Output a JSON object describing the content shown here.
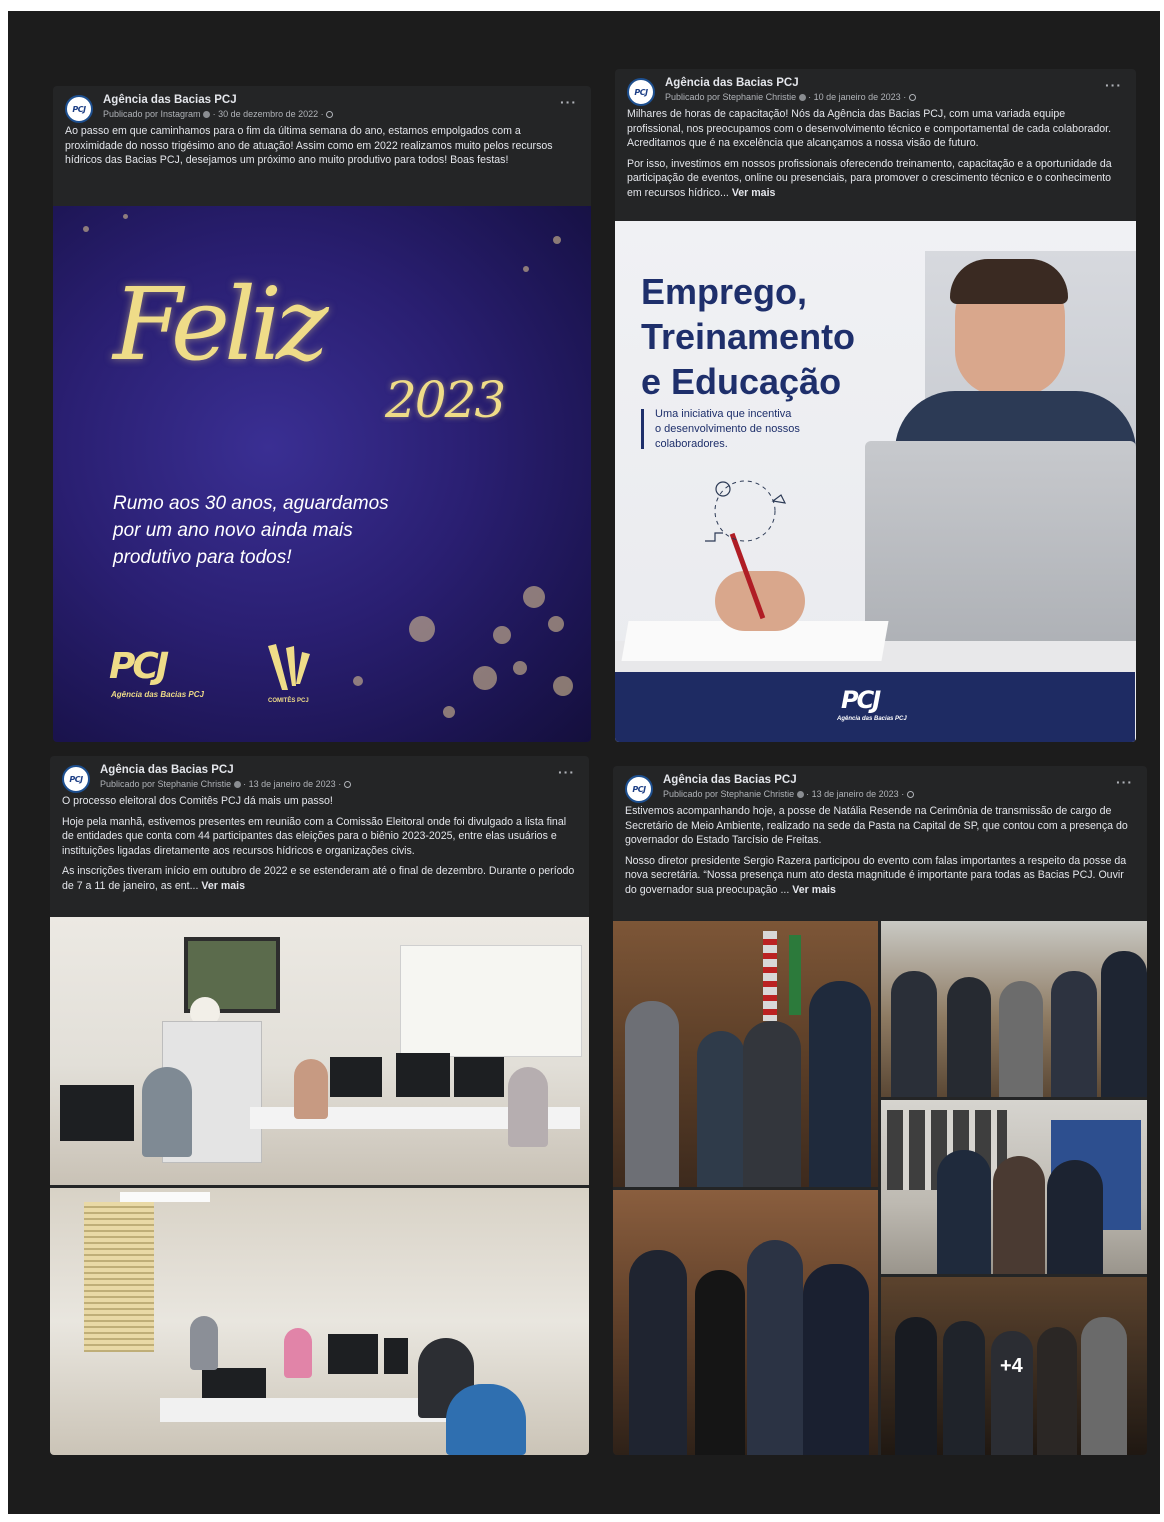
{
  "posts": [
    {
      "page_name": "Agência das Bacias PCJ",
      "meta": "Publicado por Instagram",
      "date": "30 de dezembro de 2022",
      "paragraphs": [
        "Ao passo em que caminhamos para o fim da última semana do ano, estamos empolgados com a proximidade do nosso trigésimo ano de atuação! Assim como em 2022 realizamos muito pelos recursos hídricos das Bacias PCJ, desejamos um próximo ano muito produtivo para todos! Boas festas!"
      ],
      "see_more": ""
    },
    {
      "page_name": "Agência das Bacias PCJ",
      "meta": "Publicado por Stephanie Christie",
      "date": "10 de janeiro de 2023",
      "paragraphs": [
        "Milhares de horas de capacitação! Nós da Agência das Bacias PCJ, com uma variada equipe profissional, nos preocupamos com o desenvolvimento técnico e comportamental de cada colaborador. Acreditamos que é na excelência que alcançamos a nossa visão de futuro.",
        "Por isso, investimos em nossos profissionais oferecendo treinamento, capacitação e a oportunidade da participação de eventos, online ou presenciais, para promover o crescimento técnico e o conhecimento em recursos hídrico..."
      ],
      "see_more": "Ver mais"
    },
    {
      "page_name": "Agência das Bacias PCJ",
      "meta": "Publicado por Stephanie Christie",
      "date": "13 de janeiro de 2023",
      "paragraphs": [
        "O processo eleitoral dos Comitês PCJ dá mais um passo!",
        "Hoje pela manhã, estivemos presentes em reunião com a Comissão Eleitoral onde foi divulgado a lista final de entidades que conta com 44 participantes das eleições para o biênio 2023-2025, entre elas usuários e instituições ligadas diretamente aos recursos hídricos e organizações civis.",
        "As inscrições tiveram início em outubro de 2022 e se estenderam até o final de dezembro. Durante o período de 7 a 11 de janeiro, as ent..."
      ],
      "see_more": "Ver mais"
    },
    {
      "page_name": "Agência das Bacias PCJ",
      "meta": "Publicado por Stephanie Christie",
      "date": "13 de janeiro de 2023",
      "paragraphs": [
        "Estivemos acompanhando hoje, a posse de Natália Resende na Cerimônia de transmissão de cargo de Secretário de Meio Ambiente, realizado na sede da Pasta na Capital de SP, que contou com a presença do governador do Estado Tarcísio de Freitas.",
        "Nosso diretor presidente Sergio Razera participou do evento com falas importantes a respeito da posse da nova secretária. “Nossa presença num ato desta magnitude é importante para todas as Bacias PCJ. Ouvir do governador sua preocupação ..."
      ],
      "see_more": "Ver mais"
    }
  ],
  "avatar_logo": "PCJ",
  "more_icon": "···",
  "feliz_card": {
    "script": "Feliz",
    "year": "2023",
    "subtitle": "Rumo aos 30 anos, aguardamos\npor um ano novo ainda mais\nprodutivo para todos!",
    "logo_left": "PCJ",
    "logo_left_caption": "Agência das Bacias PCJ",
    "logo_right_caption": "COMITÊS PCJ",
    "colors": {
      "bg": "#2a1f72",
      "gold": "#efdc88"
    }
  },
  "emprego_card": {
    "title": "Emprego,\nTreinamento\ne Educação",
    "subtitle": "Uma iniciativa que incentiva\no desenvolvimento de nossos\ncolaboradores.",
    "footer_logo": "PCJ",
    "footer_caption": "Agência das Bacias PCJ",
    "colors": {
      "navy": "#1e2f6b"
    }
  },
  "gallery": {
    "more_count": "+4"
  },
  "colors": {
    "frame": "#1c1c1c",
    "card": "#242526",
    "text": "#e4e6eb",
    "muted": "#b0b3b8"
  }
}
